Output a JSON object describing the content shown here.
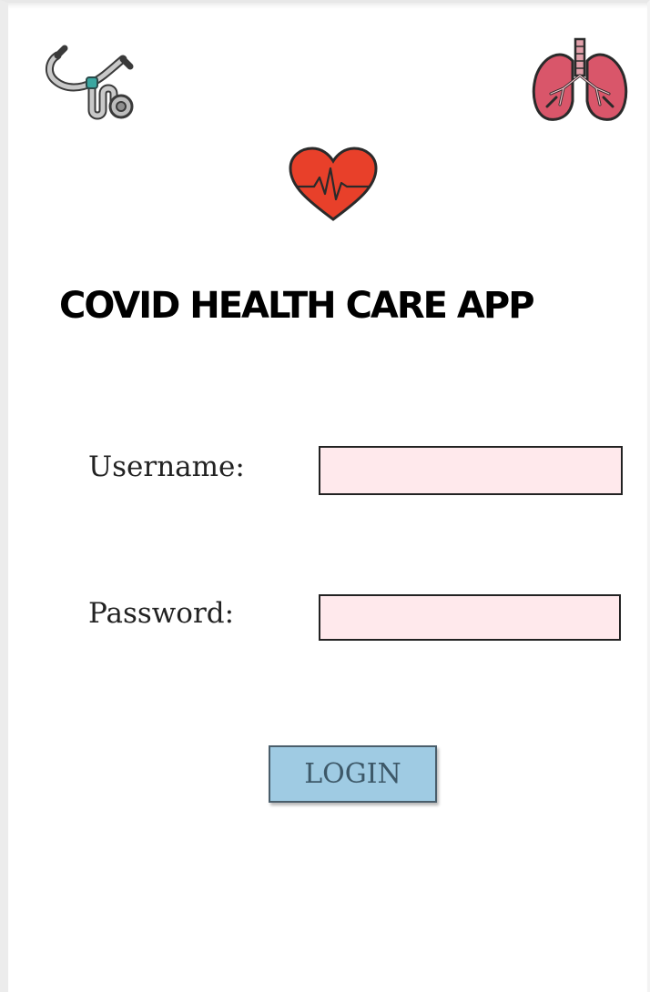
{
  "app": {
    "title": "COVID HEALTH CARE APP"
  },
  "icons": {
    "top_left": "stethoscope-icon",
    "top_right": "lungs-icon",
    "center": "heart-pulse-icon"
  },
  "form": {
    "username_label": "Username:",
    "username_value": "",
    "password_label": "Password:",
    "password_value": "",
    "login_label": "LOGIN"
  },
  "colors": {
    "input_background": "#ffe9ec",
    "button_background": "#9fcbe3",
    "button_text": "#3d5868",
    "heart": "#e8402a",
    "lungs": "#d9566a"
  }
}
